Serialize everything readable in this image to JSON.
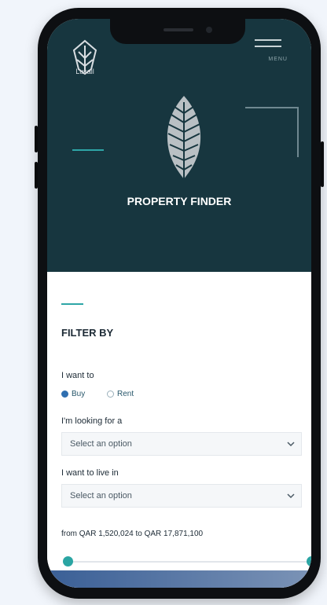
{
  "header": {
    "logo_text": "Lusail",
    "menu_label": "MENU"
  },
  "hero": {
    "title": "PROPERTY FINDER"
  },
  "filter": {
    "title": "FILTER BY",
    "want_to": {
      "label": "I want to",
      "options": [
        "Buy",
        "Rent"
      ],
      "selected": "Buy"
    },
    "looking_for": {
      "label": "I'm looking for a",
      "value": "Select an option"
    },
    "live_in": {
      "label": "I want to live in",
      "value": "Select an option"
    },
    "price_range": {
      "label": "from QAR 1,520,024 to QAR 17,871,100"
    }
  },
  "colors": {
    "hero_bg": "#17363f",
    "accent_teal": "#2ea6a7",
    "radio_selected": "#2f6fb0"
  }
}
